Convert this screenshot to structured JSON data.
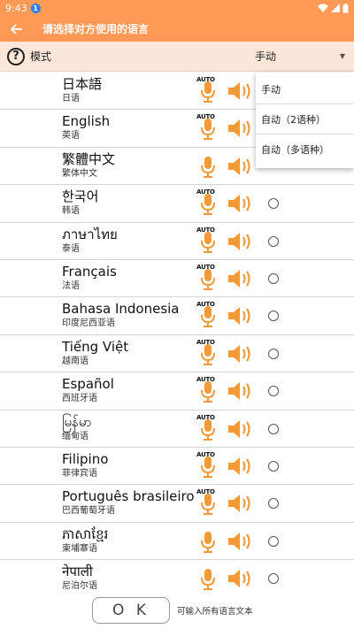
{
  "status_bar": {
    "time": "9:43",
    "notification_badge": "1"
  },
  "header": {
    "title": "请选择对方使用的语言",
    "back_icon": "arrow-left-icon"
  },
  "mode_bar": {
    "help_icon": "?",
    "label": "模式",
    "selected": "手动"
  },
  "dropdown": {
    "options": [
      "手动",
      "自动（2语种）",
      "自动（多语种）"
    ]
  },
  "languages": [
    {
      "native": "日本語",
      "chinese": "日语",
      "auto": true
    },
    {
      "native": "English",
      "chinese": "英语",
      "auto": true
    },
    {
      "native": "繁體中文",
      "chinese": "繁体中文",
      "auto": false
    },
    {
      "native": "한국어",
      "chinese": "韩语",
      "auto": true
    },
    {
      "native": "ภาษาไทย",
      "chinese": "泰语",
      "auto": true
    },
    {
      "native": "Français",
      "chinese": "法语",
      "auto": true
    },
    {
      "native": "Bahasa Indonesia",
      "chinese": "印度尼西亚语",
      "auto": true
    },
    {
      "native": "Tiếng Việt",
      "chinese": "越南语",
      "auto": true
    },
    {
      "native": "Español",
      "chinese": "西班牙语",
      "auto": true
    },
    {
      "native": "မြန်မာ",
      "chinese": "缅甸语",
      "auto": true
    },
    {
      "native": "Filipino",
      "chinese": "菲律宾语",
      "auto": true
    },
    {
      "native": "Português brasileiro",
      "chinese": "巴西葡萄牙语",
      "auto": true
    },
    {
      "native": "ភាសាខ្មែរ",
      "chinese": "柬埔寨语",
      "auto": false
    },
    {
      "native": "नेपाली",
      "chinese": "尼泊尔语",
      "auto": false
    }
  ],
  "auto_tag": "AUTO",
  "footer": {
    "ok_label": "O K",
    "note": "可输入所有语言文本"
  },
  "colors": {
    "accent": "#ff9a56",
    "mode_bar_bg": "#fbe7d9",
    "icon_orange": "#f39a38"
  }
}
